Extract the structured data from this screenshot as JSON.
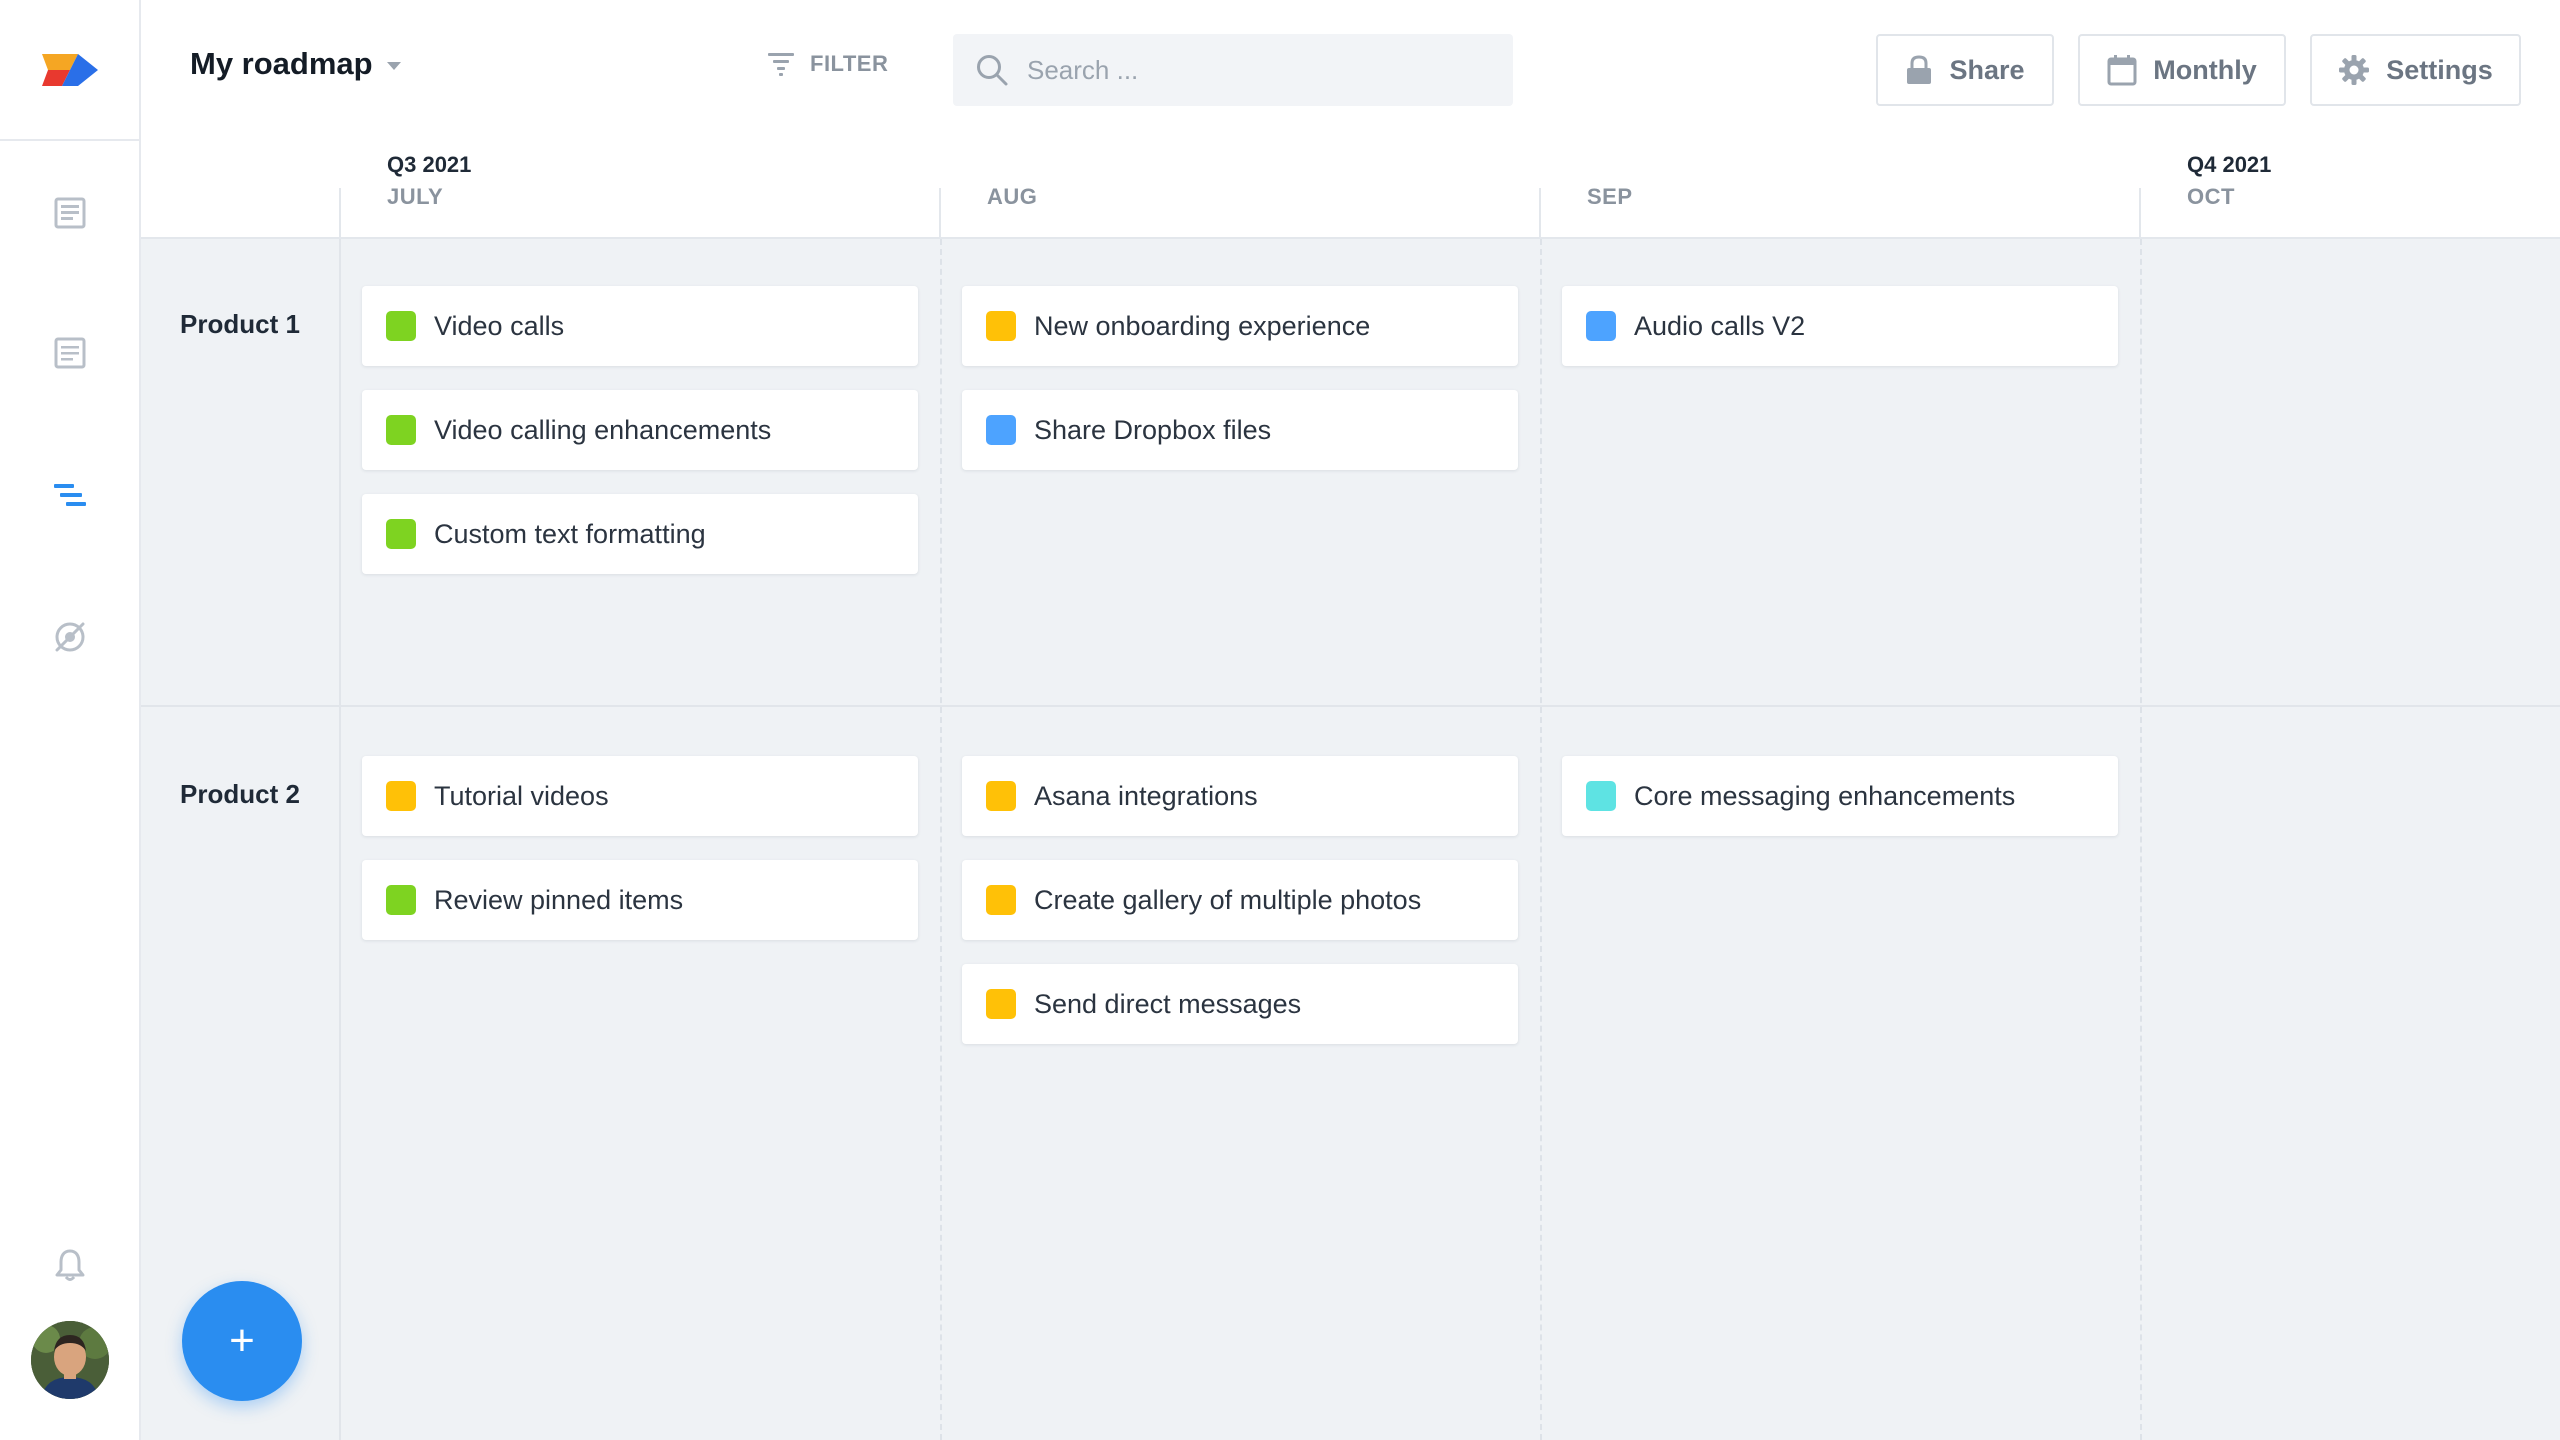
{
  "header": {
    "title": "My roadmap",
    "filter_label": "FILTER",
    "search_placeholder": "Search ...",
    "share_label": "Share",
    "view_label": "Monthly",
    "settings_label": "Settings"
  },
  "timeline": {
    "columns": [
      {
        "quarter": "Q3 2021",
        "month": "JULY"
      },
      {
        "quarter": "",
        "month": "AUG"
      },
      {
        "quarter": "",
        "month": "SEP"
      },
      {
        "quarter": "Q4 2021",
        "month": "OCT"
      }
    ]
  },
  "lanes": [
    {
      "label": "Product 1",
      "columns": [
        [
          {
            "title": "Video calls",
            "color": "#7ed321"
          },
          {
            "title": "Video calling enhancements",
            "color": "#7ed321"
          },
          {
            "title": "Custom text formatting",
            "color": "#7ed321"
          }
        ],
        [
          {
            "title": "New onboarding experience",
            "color": "#ffc107"
          },
          {
            "title": "Share Dropbox files",
            "color": "#4da3ff"
          }
        ],
        [
          {
            "title": "Audio calls V2",
            "color": "#4da3ff"
          }
        ],
        []
      ]
    },
    {
      "label": "Product 2",
      "columns": [
        [
          {
            "title": "Tutorial videos",
            "color": "#ffc107"
          },
          {
            "title": "Review pinned items",
            "color": "#7ed321"
          }
        ],
        [
          {
            "title": "Asana integrations",
            "color": "#ffc107"
          },
          {
            "title": "Create gallery of multiple photos",
            "color": "#ffc107"
          },
          {
            "title": "Send direct messages",
            "color": "#ffc107"
          }
        ],
        [
          {
            "title": "Core messaging enhancements",
            "color": "#5ee3e3"
          }
        ],
        []
      ]
    }
  ],
  "sidebar": {
    "items": [
      {
        "icon": "document-icon"
      },
      {
        "icon": "list-document-icon"
      },
      {
        "icon": "roadmap-icon",
        "active": true
      },
      {
        "icon": "hidden-view-icon"
      },
      {
        "icon": "bell-icon"
      }
    ]
  },
  "fab": {
    "label": "+"
  },
  "colors": {
    "accent": "#2a8df0",
    "green": "#7ed321",
    "yellow": "#ffc107",
    "blue": "#4da3ff",
    "teal": "#5ee3e3"
  }
}
